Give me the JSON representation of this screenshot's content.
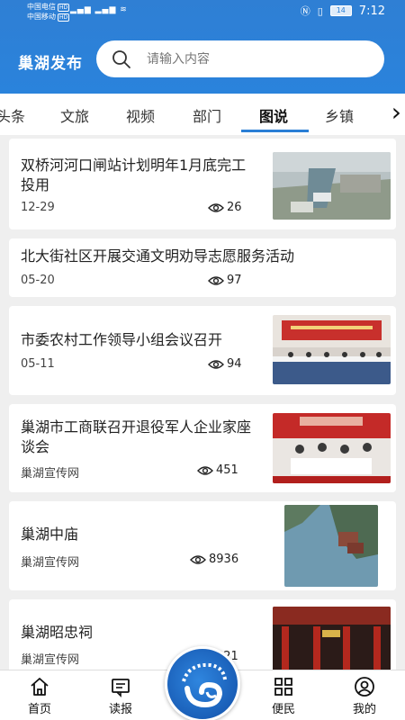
{
  "status_bar": {
    "carrier1": "中国电信",
    "carrier2": "中国移动",
    "hd": "HD",
    "battery": "14",
    "time": "7:12"
  },
  "header": {
    "title": "巢湖发布",
    "search_placeholder": "请输入内容"
  },
  "tabs": {
    "items": [
      "头条",
      "文旅",
      "视频",
      "部门",
      "图说",
      "乡镇"
    ],
    "active": "图说",
    "more_icon": "chevron-right-icon"
  },
  "news": [
    {
      "title": "双桥河河口闸站计划明年1月底完工投用",
      "meta": "12-29",
      "views": "26",
      "thumb": "aerial-construction"
    },
    {
      "title": "北大街社区开展交通文明劝导志愿服务活动",
      "meta": "05-20",
      "views": "97"
    },
    {
      "title": "市委农村工作领导小组会议召开",
      "meta": "05-11",
      "views": "94",
      "thumb": "meeting-hall"
    },
    {
      "title": "巢湖市工商联召开退役军人企业家座谈会",
      "meta": "巢湖宣传网",
      "views": "451",
      "thumb": "conference-red"
    },
    {
      "title": "巢湖中庙",
      "meta": "巢湖宣传网",
      "views": "8936",
      "thumb": "aerial-lake-temple"
    },
    {
      "title": "巢湖昭忠祠",
      "meta": "巢湖宣传网",
      "views": "921",
      "thumb": "red-temple"
    }
  ],
  "bottom_nav": [
    {
      "label": "首页",
      "icon": "home-icon"
    },
    {
      "label": "读报",
      "icon": "newspaper-icon"
    },
    {
      "label": "",
      "icon": "app-logo-icon"
    },
    {
      "label": "便民",
      "icon": "grid-icon"
    },
    {
      "label": "我的",
      "icon": "user-icon"
    }
  ],
  "colors": {
    "accent": "#2a7fd6",
    "header": "#2f7fd4"
  }
}
